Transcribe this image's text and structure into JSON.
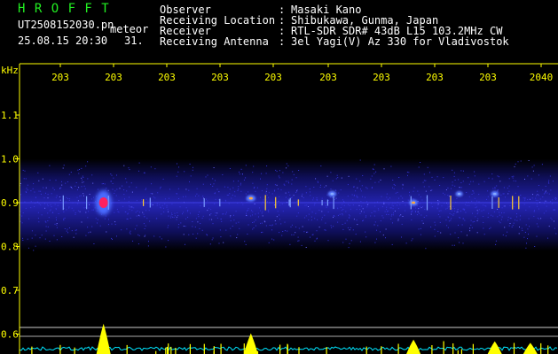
{
  "header": {
    "app_name": "H R O F F T",
    "filename": "UT2508152030.pn",
    "event_type": "meteor",
    "datetime": "25.08.15 20:30",
    "count": "31.",
    "fields": [
      {
        "label": "Observer",
        "sep": ":",
        "value": "Masaki Kano"
      },
      {
        "label": "Receiving Location",
        "sep": ":",
        "value": "Shibukawa, Gunma, Japan"
      },
      {
        "label": "Receiver",
        "sep": ":",
        "value": "RTL-SDR SDR# 43dB L15 103.2MHz CW"
      },
      {
        "label": "Receiving Antenna",
        "sep": ":",
        "value": "3el Yagi(V) Az 330 for Vladivostok"
      }
    ]
  },
  "colors": {
    "background": "#000000",
    "header_text": "#ffffff",
    "app_name": "#22ee22",
    "axis_labels": "#ffff00",
    "noise_band": "#2828c8",
    "echo_hot": "#ff2060",
    "signal_trace": "#ffff00",
    "baseline_trace": "#00e5ff"
  },
  "chart_data": {
    "type": "heatmap",
    "ylabel": "kHz",
    "yticks": [
      "1.1",
      "1.0",
      "0.9",
      "0.8",
      "0.7",
      "0.6"
    ],
    "ylim": [
      0.58,
      1.16
    ],
    "xticks": [
      "203",
      "203",
      "203",
      "203",
      "203",
      "203",
      "203",
      "203",
      "203",
      "2040"
    ],
    "noise_band_khz": [
      0.79,
      1.0
    ],
    "carrier_khz": 0.9,
    "echoes": [
      {
        "minute": 2031.3,
        "freq_khz": 0.9,
        "strength": 1.0,
        "head_echo": true
      },
      {
        "minute": 2034.2,
        "freq_khz": 0.91,
        "strength": 0.55,
        "head_echo": false
      },
      {
        "minute": 2035.8,
        "freq_khz": 0.92,
        "strength": 0.45,
        "head_echo": false
      },
      {
        "minute": 2037.4,
        "freq_khz": 0.9,
        "strength": 0.5,
        "head_echo": false
      },
      {
        "minute": 2038.3,
        "freq_khz": 0.92,
        "strength": 0.35,
        "head_echo": false
      },
      {
        "minute": 2039.0,
        "freq_khz": 0.92,
        "strength": 0.4,
        "head_echo": false
      }
    ],
    "signal_peaks": [
      {
        "minute": 2031.3,
        "level": 0.95
      },
      {
        "minute": 2034.2,
        "level": 0.65
      },
      {
        "minute": 2037.4,
        "level": 0.45
      },
      {
        "minute": 2039.0,
        "level": 0.4
      },
      {
        "minute": 2039.7,
        "level": 0.35
      }
    ],
    "grid": false
  }
}
